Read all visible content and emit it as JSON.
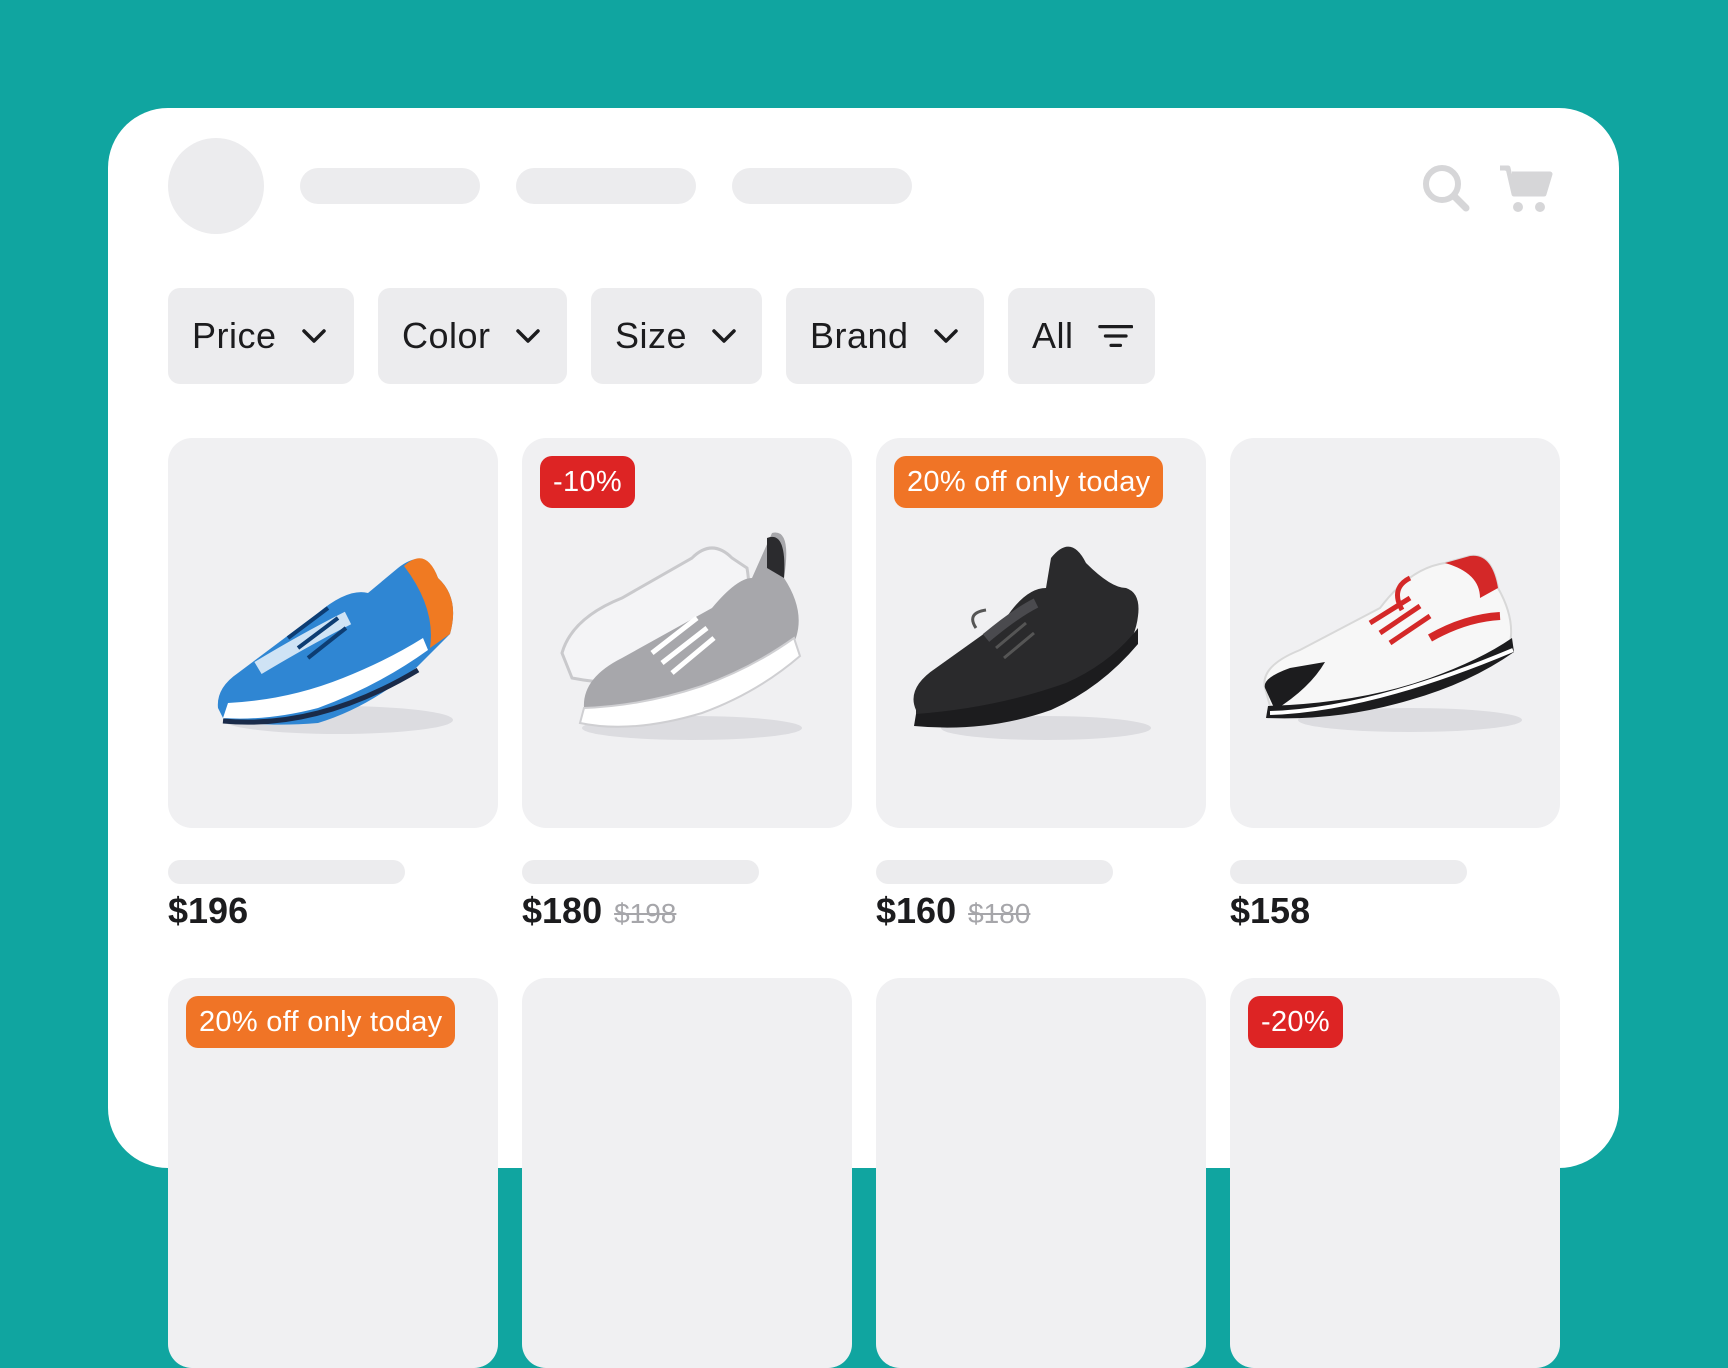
{
  "header": {
    "search_icon": "search-icon",
    "cart_icon": "cart-icon"
  },
  "filters": [
    {
      "label": "Price",
      "icon": "chevron-down-icon"
    },
    {
      "label": "Color",
      "icon": "chevron-down-icon"
    },
    {
      "label": "Size",
      "icon": "chevron-down-icon"
    },
    {
      "label": "Brand",
      "icon": "chevron-down-icon"
    },
    {
      "label": "All",
      "icon": "filter-lines-icon"
    }
  ],
  "products": [
    {
      "price": "$196",
      "old_price": "",
      "badge": "",
      "shoe_color": "blue"
    },
    {
      "price": "$180",
      "old_price": "$198",
      "badge": "-10%",
      "badge_color": "#dd2424",
      "shoe_color": "grey"
    },
    {
      "price": "$160",
      "old_price": "$180",
      "badge": "20% off only today",
      "badge_color": "#f07426",
      "shoe_color": "black"
    },
    {
      "price": "$158",
      "old_price": "",
      "badge": "",
      "shoe_color": "red"
    }
  ],
  "second_row": [
    {
      "badge": "20% off only today",
      "badge_color": "#f07426"
    },
    {
      "badge": ""
    },
    {
      "badge": ""
    },
    {
      "badge": "-20%",
      "badge_color": "#dd2424"
    }
  ],
  "colors": {
    "background": "#10a5a0",
    "badge_red": "#dd2424",
    "badge_orange": "#f07426"
  }
}
